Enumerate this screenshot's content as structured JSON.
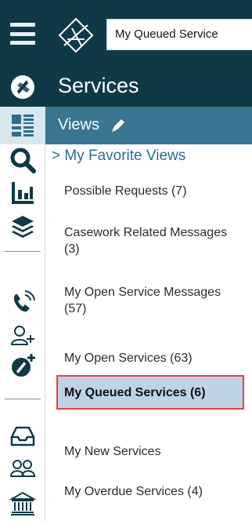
{
  "topbar": {
    "selected_view": "My Queued Service"
  },
  "colors": {
    "header_dark": "#0f3a45",
    "views_bar": "#3a7691",
    "selected_bg": "#bfd3e6",
    "selected_border": "#e04444",
    "link": "#2d6e8d"
  },
  "header": {
    "title": "Services",
    "views_label": "Views"
  },
  "menu": {
    "favorites_label": "> My Favorite Views",
    "items": [
      "Possible Requests (7)",
      "Casework Related Messages (3)",
      "My Open Service Messages (57)",
      "My Open Services (63)",
      "My Queued Services (6)",
      "My New Services",
      "My Overdue Services (4)"
    ],
    "selected_index": 4
  },
  "rail_icons": [
    "services-icon",
    "views-grid-icon",
    "search-icon",
    "chart-icon",
    "layers-icon",
    "phone-icon",
    "add-user-icon",
    "add-service-icon",
    "inbox-icon",
    "group-icon",
    "bank-icon"
  ]
}
